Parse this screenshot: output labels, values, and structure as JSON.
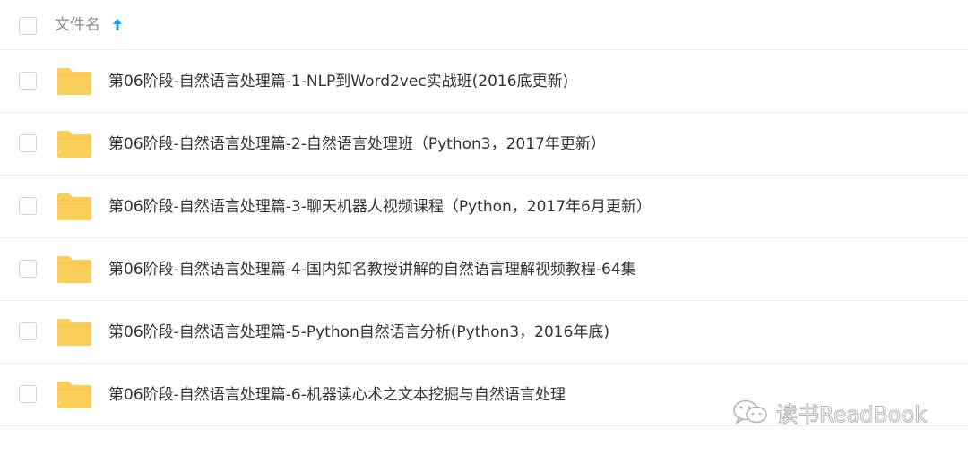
{
  "header": {
    "column_label": "文件名",
    "sort_icon": "arrow-up-icon",
    "sort_color": "#1aa3e8"
  },
  "folder_color": "#f9cf59",
  "items": [
    {
      "name": "第06阶段-自然语言处理篇-1-NLP到Word2vec实战班(2016底更新)",
      "icon": "folder-icon"
    },
    {
      "name": "第06阶段-自然语言处理篇-2-自然语言处理班（Python3，2017年更新）",
      "icon": "folder-icon"
    },
    {
      "name": "第06阶段-自然语言处理篇-3-聊天机器人视频课程（Python，2017年6月更新）",
      "icon": "folder-icon"
    },
    {
      "name": "第06阶段-自然语言处理篇-4-国内知名教授讲解的自然语言理解视频教程-64集",
      "icon": "folder-icon"
    },
    {
      "name": "第06阶段-自然语言处理篇-5-Python自然语言分析(Python3，2016年底)",
      "icon": "folder-icon"
    },
    {
      "name": "第06阶段-自然语言处理篇-6-机器读心术之文本挖掘与自然语言处理",
      "icon": "folder-icon"
    }
  ],
  "watermark": {
    "text": "读书ReadBook",
    "icon": "wechat-icon"
  }
}
